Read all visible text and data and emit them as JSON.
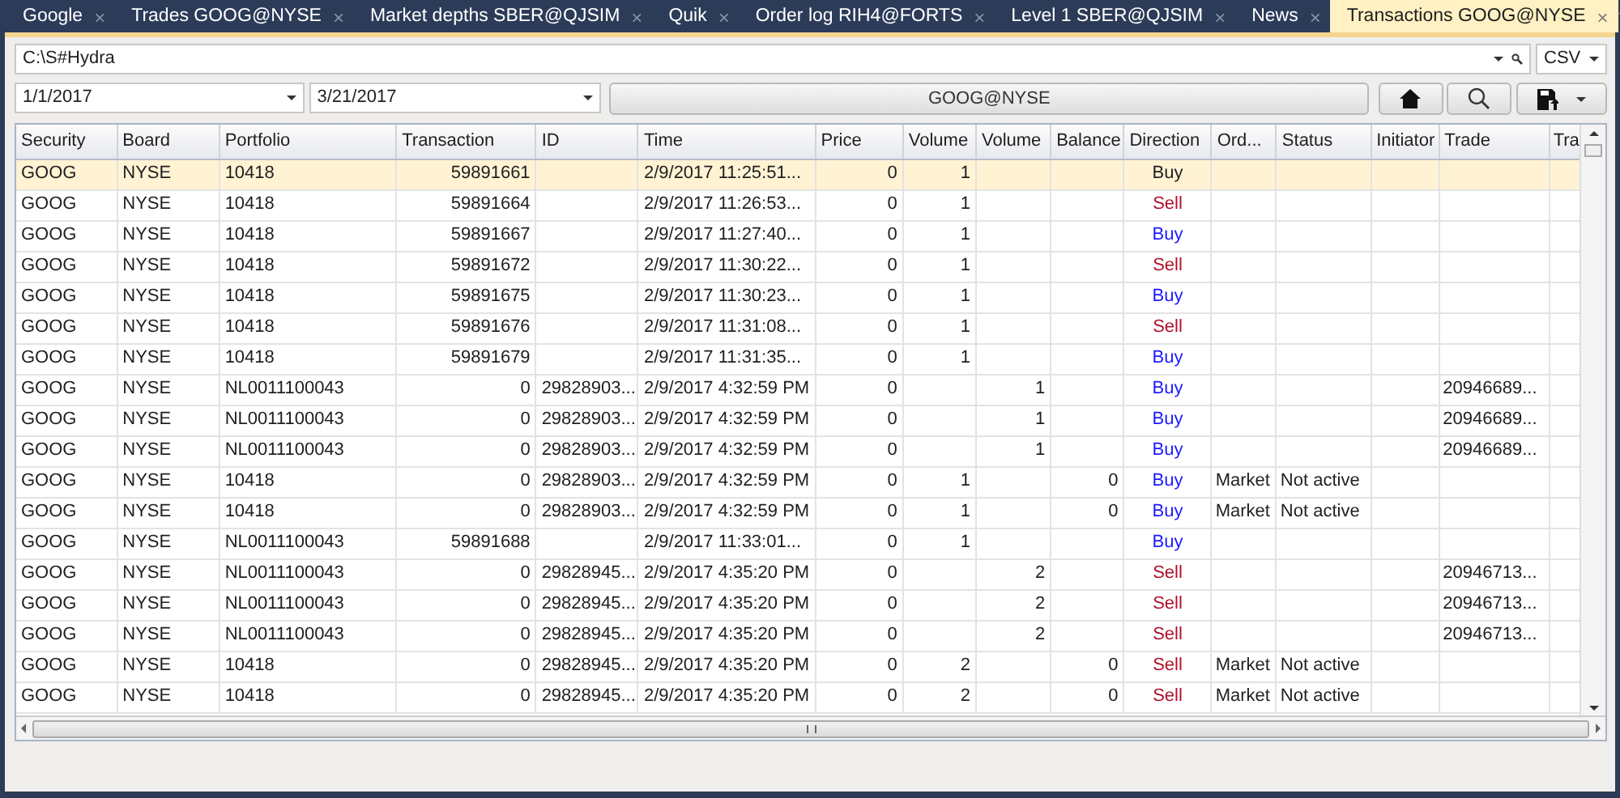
{
  "tabs": [
    {
      "label": "Google",
      "selected": false
    },
    {
      "label": "Trades GOOG@NYSE",
      "selected": false
    },
    {
      "label": "Market depths SBER@QJSIM",
      "selected": false
    },
    {
      "label": "Quik",
      "selected": false
    },
    {
      "label": "Order log RIH4@FORTS",
      "selected": false
    },
    {
      "label": "Level 1 SBER@QJSIM",
      "selected": false
    },
    {
      "label": "News",
      "selected": false
    },
    {
      "label": "Transactions GOOG@NYSE",
      "selected": true
    }
  ],
  "close_glyph": "×",
  "path_field": {
    "value": "C:\\S#Hydra"
  },
  "format_select": {
    "value": "CSV"
  },
  "date_from": {
    "value": "1/1/2017"
  },
  "date_to": {
    "value": "3/21/2017"
  },
  "security_button": {
    "label": "GOOG@NYSE"
  },
  "table": {
    "columns": [
      "Security",
      "Board",
      "Portfolio",
      "Transaction",
      "ID",
      "Time",
      "Price",
      "Volume",
      "Volume",
      "Balance",
      "Direction",
      "Ord...",
      "Status",
      "Initiator",
      "Trade",
      "Tra"
    ],
    "rows": [
      {
        "selected": true,
        "color": "#1e1e1e",
        "cells": [
          "GOOG",
          "NYSE",
          "10418",
          "59891661",
          "",
          "2/9/2017 11:25:51...",
          "0",
          "1",
          "",
          "",
          "Buy",
          "",
          "",
          "",
          "",
          ""
        ]
      },
      {
        "selected": false,
        "color": "#b0102a",
        "cells": [
          "GOOG",
          "NYSE",
          "10418",
          "59891664",
          "",
          "2/9/2017 11:26:53...",
          "0",
          "1",
          "",
          "",
          "Sell",
          "",
          "",
          "",
          "",
          ""
        ]
      },
      {
        "selected": false,
        "color": "#1a1aff",
        "cells": [
          "GOOG",
          "NYSE",
          "10418",
          "59891667",
          "",
          "2/9/2017 11:27:40...",
          "0",
          "1",
          "",
          "",
          "Buy",
          "",
          "",
          "",
          "",
          ""
        ]
      },
      {
        "selected": false,
        "color": "#b0102a",
        "cells": [
          "GOOG",
          "NYSE",
          "10418",
          "59891672",
          "",
          "2/9/2017 11:30:22...",
          "0",
          "1",
          "",
          "",
          "Sell",
          "",
          "",
          "",
          "",
          ""
        ]
      },
      {
        "selected": false,
        "color": "#1a1aff",
        "cells": [
          "GOOG",
          "NYSE",
          "10418",
          "59891675",
          "",
          "2/9/2017 11:30:23...",
          "0",
          "1",
          "",
          "",
          "Buy",
          "",
          "",
          "",
          "",
          ""
        ]
      },
      {
        "selected": false,
        "color": "#b0102a",
        "cells": [
          "GOOG",
          "NYSE",
          "10418",
          "59891676",
          "",
          "2/9/2017 11:31:08...",
          "0",
          "1",
          "",
          "",
          "Sell",
          "",
          "",
          "",
          "",
          ""
        ]
      },
      {
        "selected": false,
        "color": "#1a1aff",
        "cells": [
          "GOOG",
          "NYSE",
          "10418",
          "59891679",
          "",
          "2/9/2017 11:31:35...",
          "0",
          "1",
          "",
          "",
          "Buy",
          "",
          "",
          "",
          "",
          ""
        ]
      },
      {
        "selected": false,
        "color": "#1a1aff",
        "cells": [
          "GOOG",
          "NYSE",
          "NL0011100043",
          "0",
          "29828903...",
          "2/9/2017 4:32:59 PM",
          "0",
          "",
          "1",
          "",
          "Buy",
          "",
          "",
          "",
          "20946689...",
          ""
        ]
      },
      {
        "selected": false,
        "color": "#1a1aff",
        "cells": [
          "GOOG",
          "NYSE",
          "NL0011100043",
          "0",
          "29828903...",
          "2/9/2017 4:32:59 PM",
          "0",
          "",
          "1",
          "",
          "Buy",
          "",
          "",
          "",
          "20946689...",
          ""
        ]
      },
      {
        "selected": false,
        "color": "#1a1aff",
        "cells": [
          "GOOG",
          "NYSE",
          "NL0011100043",
          "0",
          "29828903...",
          "2/9/2017 4:32:59 PM",
          "0",
          "",
          "1",
          "",
          "Buy",
          "",
          "",
          "",
          "20946689...",
          ""
        ]
      },
      {
        "selected": false,
        "color": "#1a1aff",
        "cells": [
          "GOOG",
          "NYSE",
          "10418",
          "0",
          "29828903...",
          "2/9/2017 4:32:59 PM",
          "0",
          "1",
          "",
          "0",
          "Buy",
          "Market",
          "Not active",
          "",
          "",
          ""
        ]
      },
      {
        "selected": false,
        "color": "#1a1aff",
        "cells": [
          "GOOG",
          "NYSE",
          "10418",
          "0",
          "29828903...",
          "2/9/2017 4:32:59 PM",
          "0",
          "1",
          "",
          "0",
          "Buy",
          "Market",
          "Not active",
          "",
          "",
          ""
        ]
      },
      {
        "selected": false,
        "color": "#1a1aff",
        "cells": [
          "GOOG",
          "NYSE",
          "NL0011100043",
          "59891688",
          "",
          "2/9/2017 11:33:01...",
          "0",
          "1",
          "",
          "",
          "Buy",
          "",
          "",
          "",
          "",
          ""
        ]
      },
      {
        "selected": false,
        "color": "#b0102a",
        "cells": [
          "GOOG",
          "NYSE",
          "NL0011100043",
          "0",
          "29828945...",
          "2/9/2017 4:35:20 PM",
          "0",
          "",
          "2",
          "",
          "Sell",
          "",
          "",
          "",
          "20946713...",
          ""
        ]
      },
      {
        "selected": false,
        "color": "#b0102a",
        "cells": [
          "GOOG",
          "NYSE",
          "NL0011100043",
          "0",
          "29828945...",
          "2/9/2017 4:35:20 PM",
          "0",
          "",
          "2",
          "",
          "Sell",
          "",
          "",
          "",
          "20946713...",
          ""
        ]
      },
      {
        "selected": false,
        "color": "#b0102a",
        "cells": [
          "GOOG",
          "NYSE",
          "NL0011100043",
          "0",
          "29828945...",
          "2/9/2017 4:35:20 PM",
          "0",
          "",
          "2",
          "",
          "Sell",
          "",
          "",
          "",
          "20946713...",
          ""
        ]
      },
      {
        "selected": false,
        "color": "#b0102a",
        "cells": [
          "GOOG",
          "NYSE",
          "10418",
          "0",
          "29828945...",
          "2/9/2017 4:35:20 PM",
          "0",
          "2",
          "",
          "0",
          "Sell",
          "Market",
          "Not active",
          "",
          "",
          ""
        ]
      },
      {
        "selected": false,
        "color": "#b0102a",
        "cells": [
          "GOOG",
          "NYSE",
          "10418",
          "0",
          "29828945...",
          "2/9/2017 4:35:20 PM",
          "0",
          "2",
          "",
          "0",
          "Sell",
          "Market",
          "Not active",
          "",
          "",
          ""
        ]
      }
    ]
  }
}
